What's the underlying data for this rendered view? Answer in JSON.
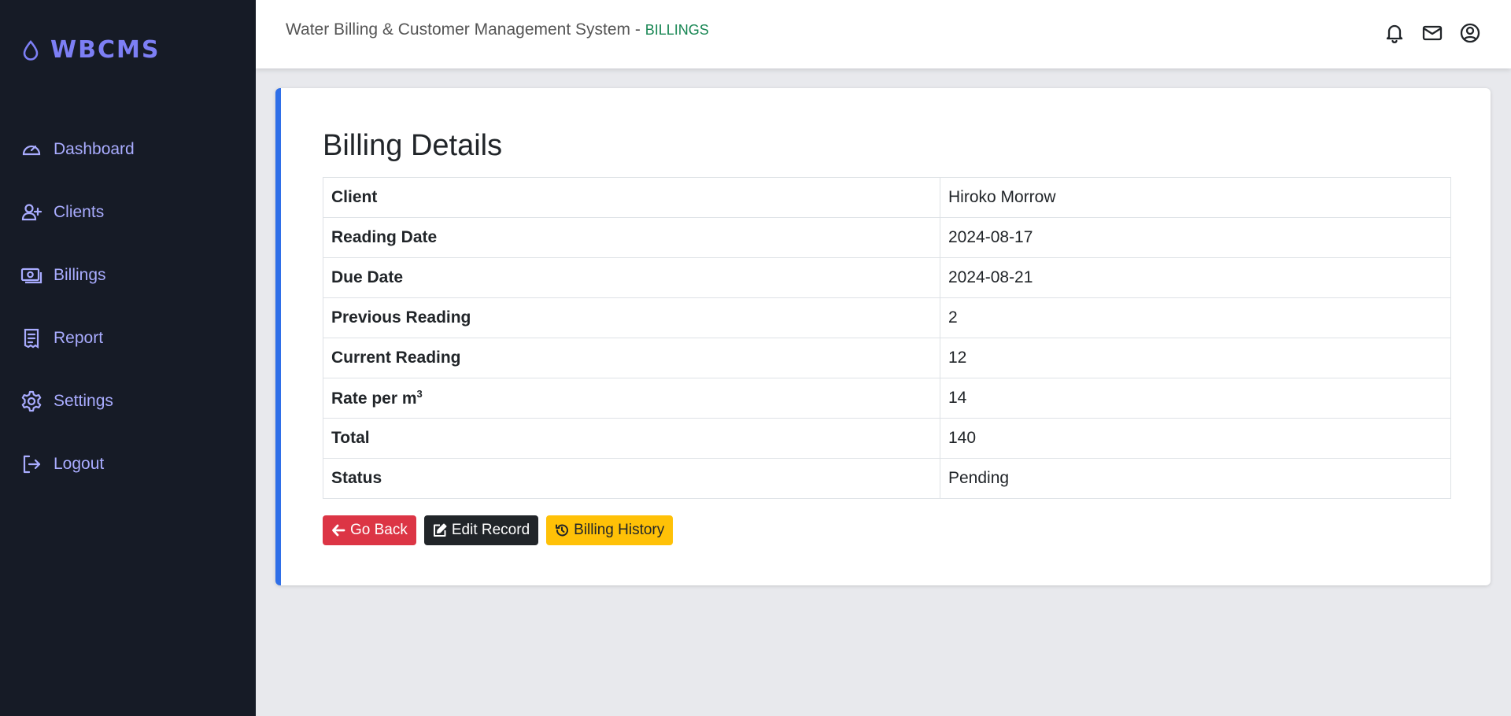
{
  "app": {
    "brand": "WBCMS",
    "title": "Water Billing & Customer Management System - ",
    "section": "BILLINGS"
  },
  "sidebar": {
    "items": [
      {
        "label": "Dashboard",
        "icon": "gauge-icon"
      },
      {
        "label": "Clients",
        "icon": "user-plus-icon"
      },
      {
        "label": "Billings",
        "icon": "money-bill-icon"
      },
      {
        "label": "Report",
        "icon": "receipt-icon"
      },
      {
        "label": "Settings",
        "icon": "gear-icon"
      },
      {
        "label": "Logout",
        "icon": "logout-icon"
      }
    ]
  },
  "header_icons": [
    "bell-icon",
    "mail-icon",
    "user-circle-icon"
  ],
  "card": {
    "title": "Billing Details",
    "rows": [
      {
        "label": "Client",
        "value": "Hiroko Morrow"
      },
      {
        "label": "Reading Date",
        "value": "2024-08-17"
      },
      {
        "label": "Due Date",
        "value": "2024-08-21"
      },
      {
        "label": "Previous Reading",
        "value": "2"
      },
      {
        "label": "Current Reading",
        "value": "12"
      },
      {
        "label": "Rate per m",
        "label_sup": "3",
        "value": "14"
      },
      {
        "label": "Total",
        "value": "140"
      },
      {
        "label": "Status",
        "value": "Pending"
      }
    ],
    "buttons": {
      "back": "Go Back",
      "edit": "Edit Record",
      "history": "Billing History"
    }
  },
  "colors": {
    "sidebar_bg": "#161b26",
    "brand": "#7d7ff5",
    "nav_text": "#a9acff",
    "accent_border": "#2f6fe8",
    "section_green": "#198754",
    "btn_red": "#dc3545",
    "btn_dark": "#212529",
    "btn_yellow": "#ffc107"
  }
}
